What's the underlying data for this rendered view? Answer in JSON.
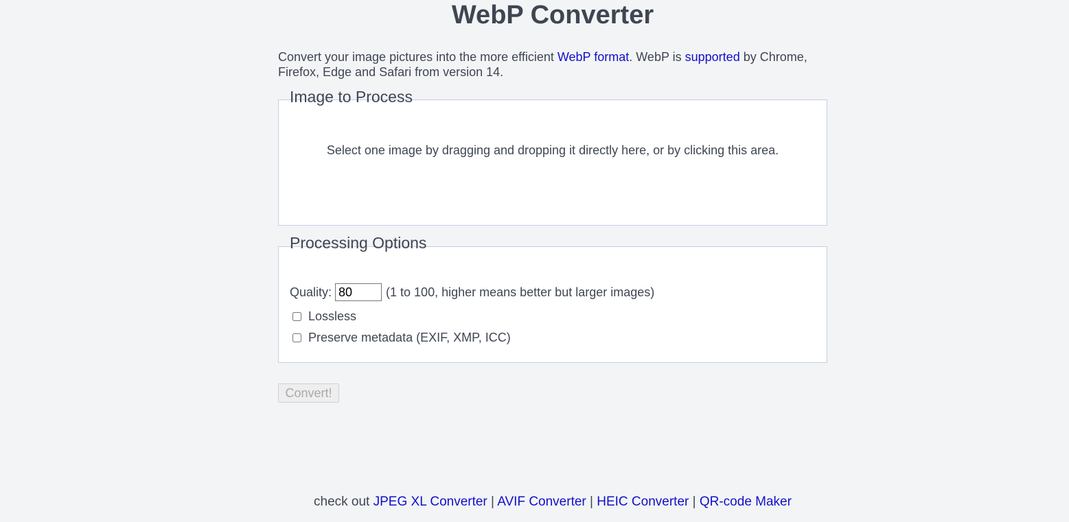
{
  "header": {
    "title": "WebP Converter"
  },
  "intro": {
    "text1": "Convert your image pictures into the more efficient ",
    "link1": "WebP format",
    "text2": ". WebP is ",
    "link2": "supported",
    "text3": " by Chrome, Firefox, Edge and Safari from version 14."
  },
  "image_section": {
    "legend": "Image to Process",
    "dropzone_text": "Select one image by dragging and dropping it directly here, or by clicking this area."
  },
  "options_section": {
    "legend": "Processing Options",
    "quality_label": "Quality:",
    "quality_value": "80",
    "quality_hint": "(1 to 100, higher means better but larger images)",
    "lossless_label": "Lossless",
    "lossless_checked": false,
    "metadata_label": "Preserve metadata (EXIF, XMP, ICC)",
    "metadata_checked": false
  },
  "actions": {
    "convert_label": "Convert!"
  },
  "footer": {
    "prefix": "check out ",
    "links": [
      "JPEG XL Converter",
      "AVIF Converter",
      "HEIC Converter",
      "QR-code Maker"
    ],
    "separator": " | "
  },
  "colors": {
    "background": "#f3f4f6",
    "text": "#3f4652",
    "link": "#1010c8",
    "box_border": "#c9cbe8"
  }
}
